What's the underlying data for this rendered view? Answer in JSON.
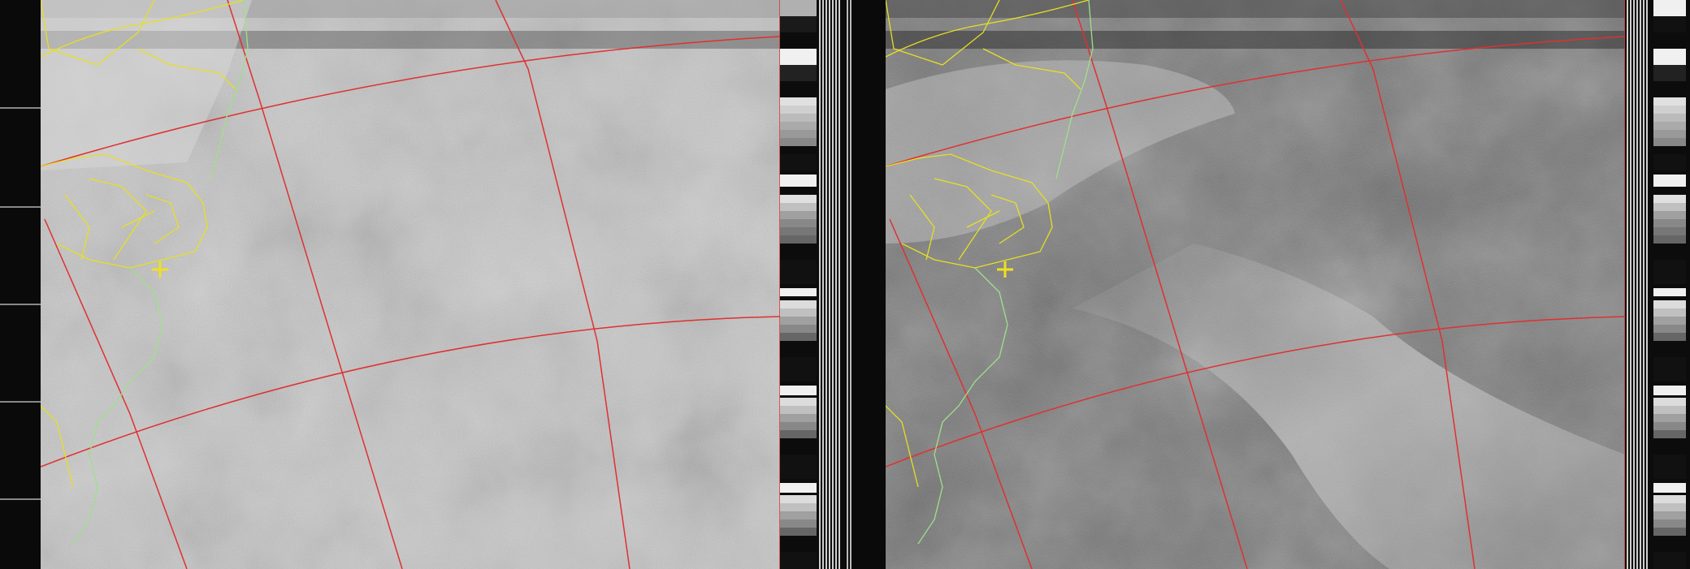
{
  "image": {
    "kind": "satellite weather image (APT), two channels side by side",
    "channels": [
      {
        "id": "A",
        "tone": "light",
        "base_color": "#c9c9c9"
      },
      {
        "id": "B",
        "tone": "dark",
        "base_color": "#6e6e6e"
      }
    ],
    "overlay_colors": {
      "grid": "#e03030",
      "country_borders": "#e6e020",
      "coastline": "#9ee08a",
      "marker": "#f0e020"
    }
  }
}
